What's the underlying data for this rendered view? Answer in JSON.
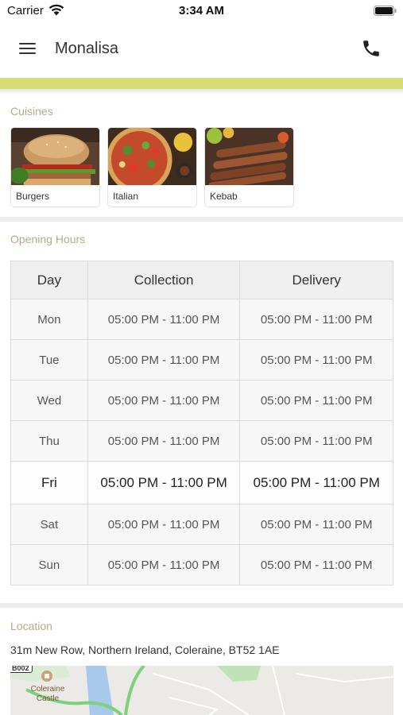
{
  "status_bar": {
    "carrier": "Carrier",
    "time": "3:34 AM"
  },
  "nav": {
    "title": "Monalisa"
  },
  "colors": {
    "accent": "#d6dd74",
    "section_title": "#b8a98a"
  },
  "cuisines": {
    "title": "Cuisines",
    "items": [
      {
        "label": "Burgers"
      },
      {
        "label": "Italian"
      },
      {
        "label": "Kebab"
      }
    ]
  },
  "opening_hours": {
    "title": "Opening Hours",
    "headers": {
      "day": "Day",
      "collection": "Collection",
      "delivery": "Delivery"
    },
    "rows": [
      {
        "day": "Mon",
        "collection": "05:00 PM - 11:00 PM",
        "delivery": "05:00 PM - 11:00 PM"
      },
      {
        "day": "Tue",
        "collection": "05:00 PM - 11:00 PM",
        "delivery": "05:00 PM - 11:00 PM"
      },
      {
        "day": "Wed",
        "collection": "05:00 PM - 11:00 PM",
        "delivery": "05:00 PM - 11:00 PM"
      },
      {
        "day": "Thu",
        "collection": "05:00 PM - 11:00 PM",
        "delivery": "05:00 PM - 11:00 PM"
      },
      {
        "day": "Fri",
        "collection": "05:00 PM - 11:00 PM",
        "delivery": "05:00 PM - 11:00 PM"
      },
      {
        "day": "Sat",
        "collection": "05:00 PM - 11:00 PM",
        "delivery": "05:00 PM - 11:00 PM"
      },
      {
        "day": "Sun",
        "collection": "05:00 PM - 11:00 PM",
        "delivery": "05:00 PM - 11:00 PM"
      }
    ]
  },
  "location": {
    "title": "Location",
    "address": "31m New Row, Northern Ireland, Coleraine, BT52 1AE",
    "map": {
      "road_number": "B002",
      "place_label": "Coleraine Castle"
    }
  }
}
